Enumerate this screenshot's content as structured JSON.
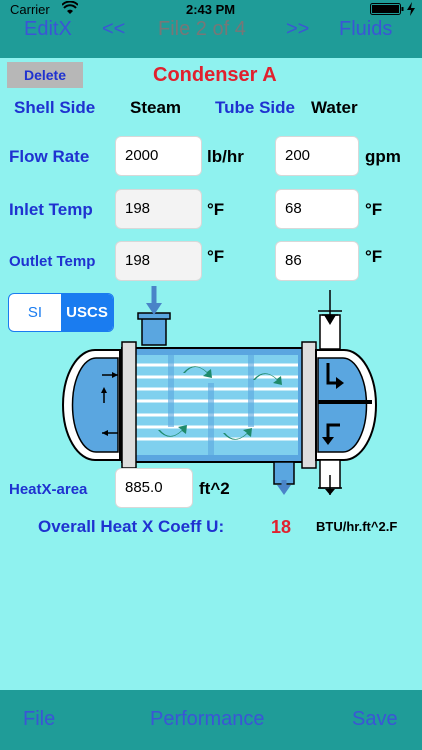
{
  "status": {
    "carrier": "Carrier",
    "time": "2:43 PM"
  },
  "nav": {
    "left": "EditX",
    "prev": "<<",
    "title": "File 2 of 4",
    "next": ">>",
    "right": "Fluids"
  },
  "delete_label": "Delete",
  "exchanger_name": "Condenser A",
  "shell_side": {
    "label": "Shell Side",
    "value": "Steam"
  },
  "tube_side": {
    "label": "Tube Side",
    "value": "Water"
  },
  "flow_rate": {
    "label": "Flow Rate",
    "shell_value": "2000",
    "shell_unit": "lb/hr",
    "tube_value": "200",
    "tube_unit": "gpm"
  },
  "inlet_temp": {
    "label": "Inlet Temp",
    "shell_value": "198",
    "shell_unit": "°F",
    "tube_value": "68",
    "tube_unit": "°F"
  },
  "outlet_temp": {
    "label": "Outlet Temp",
    "shell_value": "198",
    "shell_unit": "°F",
    "tube_value": "86",
    "tube_unit": "°F"
  },
  "units_toggle": {
    "si": "SI",
    "uscs": "USCS",
    "selected": "USCS"
  },
  "heatx_area": {
    "label": "HeatX-area",
    "value": "885.0",
    "unit": "ft^2"
  },
  "overall_u": {
    "label": "Overall Heat X Coeff U:",
    "value": "18",
    "unit": "BTU/hr.ft^2.F"
  },
  "bottom": {
    "file": "File",
    "performance": "Performance",
    "save": "Save"
  },
  "colors": {
    "background": "#8ff2ef",
    "bar": "#1f9c98",
    "label_blue": "#1f32d0",
    "title_red": "#e0212e",
    "u_value_red": "#e0212e",
    "toggle_blue": "#1a7cf0"
  }
}
